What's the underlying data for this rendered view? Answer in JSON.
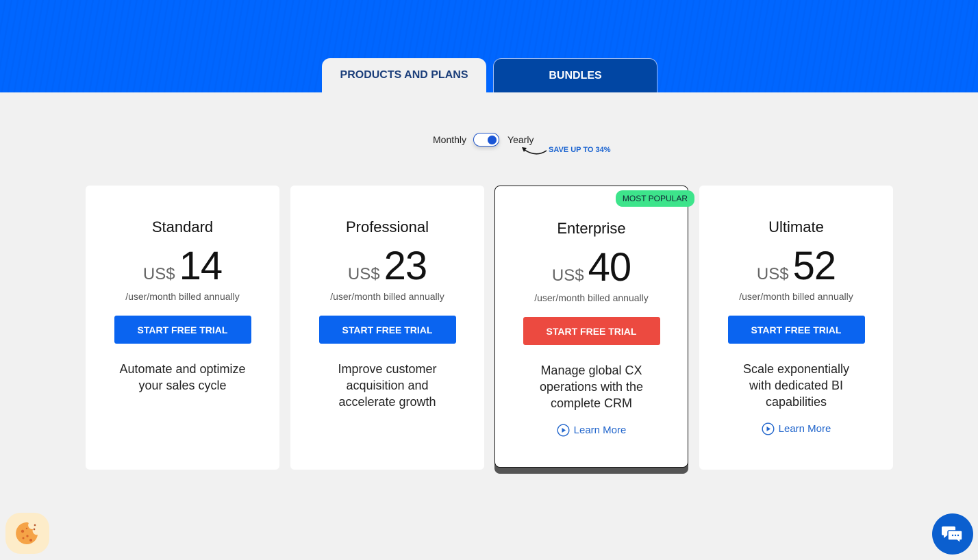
{
  "tabs": [
    {
      "label": "PRODUCTS AND PLANS",
      "active": true
    },
    {
      "label": "BUNDLES",
      "active": false
    }
  ],
  "billing_toggle": {
    "left_label": "Monthly",
    "right_label": "Yearly",
    "selected": "Yearly",
    "promo": "SAVE UP TO 34%"
  },
  "plans": [
    {
      "name": "Standard",
      "currency": "US$",
      "price": "14",
      "billing": "/user/month billed annually",
      "cta": "START FREE TRIAL",
      "description": "Automate and optimize your sales cycle"
    },
    {
      "name": "Professional",
      "currency": "US$",
      "price": "23",
      "billing": "/user/month billed annually",
      "cta": "START FREE TRIAL",
      "description": "Improve customer acquisition and accelerate growth"
    },
    {
      "name": "Enterprise",
      "currency": "US$",
      "price": "40",
      "billing": "/user/month billed annually",
      "cta": "START FREE TRIAL",
      "description": "Manage global CX operations with the complete CRM",
      "badge": "MOST POPULAR",
      "link": "Learn More"
    },
    {
      "name": "Ultimate",
      "currency": "US$",
      "price": "52",
      "billing": "/user/month billed annually",
      "cta": "START FREE TRIAL",
      "description": "Scale exponentially with dedicated BI capabilities",
      "link": "Learn More"
    }
  ],
  "colors": {
    "hero_blue": "#0066ff",
    "primary_button": "#0a64f0",
    "featured_button": "#ec4a40",
    "badge_green": "#3de48b",
    "link_blue": "#2266cc"
  },
  "widgets": {
    "cookie_icon": "cookie-icon",
    "chat_icon": "chat-icon"
  }
}
